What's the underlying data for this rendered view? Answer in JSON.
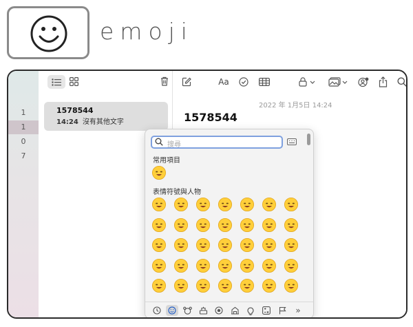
{
  "caption": "emoji",
  "window": {
    "sidebar_numbers": [
      "1",
      "1",
      "0",
      "7"
    ],
    "note": {
      "title": "1578544",
      "time": "14:24",
      "preview": "沒有其他文字"
    },
    "editor": {
      "date": "2022 年 1月5日 14:24",
      "title": "1578544",
      "font_button": "Aa"
    },
    "toolbar_icons": [
      "compose-icon",
      "format-text-icon",
      "checklist-icon",
      "table-icon",
      "lock-icon",
      "media-icon",
      "collaborate-icon",
      "share-icon",
      "search-icon"
    ]
  },
  "picker": {
    "search_placeholder": "搜尋",
    "frequent_label": "常用項目",
    "smileys_label": "表情符號與人物",
    "frequent": [
      "😜"
    ],
    "rows": [
      [
        "😀",
        "😃",
        "😄",
        "😁",
        "😆",
        "😅",
        "😂"
      ],
      [
        "🤣",
        "🥲",
        "☺️",
        "😊",
        "😇",
        "🙂",
        "🙃"
      ],
      [
        "😉",
        "😌",
        "😍",
        "🥰",
        "😘",
        "😗",
        "😙"
      ],
      [
        "😚",
        "😋",
        "😛",
        "😝",
        "😜",
        "🤪",
        "🤨"
      ],
      [
        "🧐",
        "🤓",
        "😎",
        "🥸",
        "🤩",
        "🥳",
        "😏"
      ]
    ],
    "categories": [
      "clock-icon",
      "smiley-icon",
      "animal-icon",
      "food-icon",
      "ball-icon",
      "building-icon",
      "lightbulb-icon",
      "symbols-icon",
      "flag-icon",
      "more-icon"
    ],
    "category_more": "»"
  }
}
